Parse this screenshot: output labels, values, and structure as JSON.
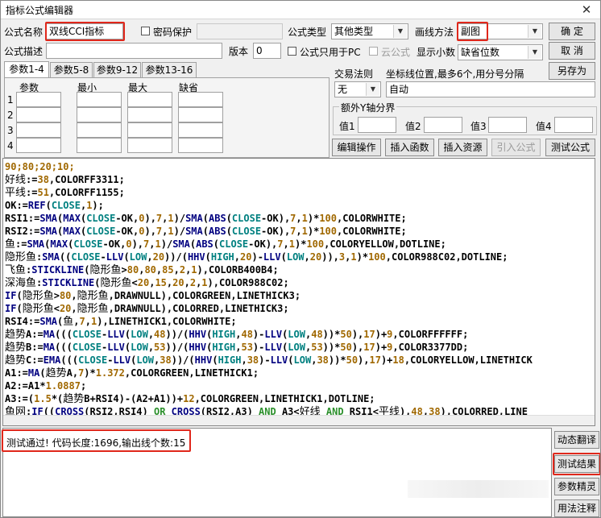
{
  "window": {
    "title": "指标公式编辑器",
    "close_glyph": "✕"
  },
  "form": {
    "name_label": "公式名称",
    "name_value": "双线CCI指标",
    "password_label": "密码保护",
    "type_label": "公式类型",
    "type_value": "其他类型",
    "draw_method_label": "画线方法",
    "draw_method_value": "副图",
    "desc_label": "公式描述",
    "version_label": "版本",
    "version_value": "0",
    "pc_only_label": "公式只用于PC",
    "cloud_label": "云公式",
    "decimals_label": "显示小数",
    "decimals_value": "缺省位数"
  },
  "buttons": {
    "ok": "确  定",
    "cancel": "取  消",
    "save_as": "另存为",
    "edit_ops": "编辑操作",
    "insert_func": "插入函数",
    "insert_res": "插入资源",
    "import_formula": "引入公式",
    "test_formula": "测试公式",
    "dynamic_translate": "动态翻译",
    "test_result": "测试结果",
    "param_wizard": "参数精灵",
    "usage_notes": "用法注释"
  },
  "tabs": [
    "参数1-4",
    "参数5-8",
    "参数9-12",
    "参数13-16"
  ],
  "params": {
    "headers": [
      "参数",
      "最小",
      "最大",
      "缺省"
    ],
    "rows": [
      "1",
      "2",
      "3",
      "4"
    ]
  },
  "trade": {
    "rule_label": "交易法则",
    "rule_value": "无",
    "axis_label": "坐标线位置,最多6个,用分号分隔",
    "axis_value": "自动",
    "extra_axis_label": "额外Y轴分界",
    "value_labels": [
      "值1",
      "值2",
      "值3",
      "值4"
    ]
  },
  "code_lines": [
    [
      [
        "90;80;20;10;",
        "y"
      ]
    ],
    [
      [
        "好线",
        "s"
      ],
      [
        ":=",
        "n"
      ],
      [
        "38",
        "y"
      ],
      [
        ",COLORFF3311;",
        "n"
      ]
    ],
    [
      [
        "平线",
        "s"
      ],
      [
        ":=",
        "n"
      ],
      [
        "51",
        "y"
      ],
      [
        ",COLORFF1155;",
        "n"
      ]
    ],
    [
      [
        "OK:=",
        "n"
      ],
      [
        "REF",
        "f"
      ],
      [
        "(",
        "n"
      ],
      [
        "CLOSE",
        "c"
      ],
      [
        ",",
        "n"
      ],
      [
        "1",
        "y"
      ],
      [
        ");",
        "n"
      ]
    ],
    [
      [
        "RSI1:=",
        "n"
      ],
      [
        "SMA",
        "f"
      ],
      [
        "(",
        "n"
      ],
      [
        "MAX",
        "f"
      ],
      [
        "(",
        "n"
      ],
      [
        "CLOSE",
        "c"
      ],
      [
        "-OK,",
        "n"
      ],
      [
        "0",
        "y"
      ],
      [
        "),",
        "n"
      ],
      [
        "7",
        "y"
      ],
      [
        ",",
        "n"
      ],
      [
        "1",
        "y"
      ],
      [
        ")/",
        "n"
      ],
      [
        "SMA",
        "f"
      ],
      [
        "(",
        "n"
      ],
      [
        "ABS",
        "f"
      ],
      [
        "(",
        "n"
      ],
      [
        "CLOSE",
        "c"
      ],
      [
        "-OK),",
        "n"
      ],
      [
        "7",
        "y"
      ],
      [
        ",",
        "n"
      ],
      [
        "1",
        "y"
      ],
      [
        ")*",
        "n"
      ],
      [
        "100",
        "y"
      ],
      [
        ",COLORWHITE;",
        "n"
      ]
    ],
    [
      [
        "RSI2:=",
        "n"
      ],
      [
        "SMA",
        "f"
      ],
      [
        "(",
        "n"
      ],
      [
        "MAX",
        "f"
      ],
      [
        "(",
        "n"
      ],
      [
        "CLOSE",
        "c"
      ],
      [
        "-OK,",
        "n"
      ],
      [
        "0",
        "y"
      ],
      [
        "),",
        "n"
      ],
      [
        "7",
        "y"
      ],
      [
        ",",
        "n"
      ],
      [
        "1",
        "y"
      ],
      [
        ")/",
        "n"
      ],
      [
        "SMA",
        "f"
      ],
      [
        "(",
        "n"
      ],
      [
        "ABS",
        "f"
      ],
      [
        "(",
        "n"
      ],
      [
        "CLOSE",
        "c"
      ],
      [
        "-OK),",
        "n"
      ],
      [
        "7",
        "y"
      ],
      [
        ",",
        "n"
      ],
      [
        "1",
        "y"
      ],
      [
        ")*",
        "n"
      ],
      [
        "100",
        "y"
      ],
      [
        ",COLORWHITE;",
        "n"
      ]
    ],
    [
      [
        "鱼",
        "s"
      ],
      [
        ":=",
        "n"
      ],
      [
        "SMA",
        "f"
      ],
      [
        "(",
        "n"
      ],
      [
        "MAX",
        "f"
      ],
      [
        "(",
        "n"
      ],
      [
        "CLOSE",
        "c"
      ],
      [
        "-OK,",
        "n"
      ],
      [
        "0",
        "y"
      ],
      [
        "),",
        "n"
      ],
      [
        "7",
        "y"
      ],
      [
        ",",
        "n"
      ],
      [
        "1",
        "y"
      ],
      [
        ")/",
        "n"
      ],
      [
        "SMA",
        "f"
      ],
      [
        "(",
        "n"
      ],
      [
        "ABS",
        "f"
      ],
      [
        "(",
        "n"
      ],
      [
        "CLOSE",
        "c"
      ],
      [
        "-OK),",
        "n"
      ],
      [
        "7",
        "y"
      ],
      [
        ",",
        "n"
      ],
      [
        "1",
        "y"
      ],
      [
        ")*",
        "n"
      ],
      [
        "100",
        "y"
      ],
      [
        ",COLORYELLOW,DOTLINE;",
        "n"
      ]
    ],
    [
      [
        "隐形鱼",
        "s"
      ],
      [
        ":",
        "n"
      ],
      [
        "SMA",
        "f"
      ],
      [
        "((",
        "n"
      ],
      [
        "CLOSE",
        "c"
      ],
      [
        "-",
        "n"
      ],
      [
        "LLV",
        "f"
      ],
      [
        "(",
        "n"
      ],
      [
        "LOW",
        "c"
      ],
      [
        ",",
        "n"
      ],
      [
        "20",
        "y"
      ],
      [
        "))/(",
        "n"
      ],
      [
        "HHV",
        "f"
      ],
      [
        "(",
        "n"
      ],
      [
        "HIGH",
        "c"
      ],
      [
        ",",
        "n"
      ],
      [
        "20",
        "y"
      ],
      [
        ")-",
        "n"
      ],
      [
        "LLV",
        "f"
      ],
      [
        "(",
        "n"
      ],
      [
        "LOW",
        "c"
      ],
      [
        ",",
        "n"
      ],
      [
        "20",
        "y"
      ],
      [
        ")),",
        "n"
      ],
      [
        "3",
        "y"
      ],
      [
        ",",
        "n"
      ],
      [
        "1",
        "y"
      ],
      [
        ")*",
        "n"
      ],
      [
        "100",
        "y"
      ],
      [
        ",COLOR988C02,DOTLINE;",
        "n"
      ]
    ],
    [
      [
        "飞鱼",
        "s"
      ],
      [
        ":",
        "n"
      ],
      [
        "STICKLINE",
        "f"
      ],
      [
        "(",
        "n"
      ],
      [
        "隐形鱼",
        "s"
      ],
      [
        ">",
        "n"
      ],
      [
        "80",
        "y"
      ],
      [
        ",",
        "n"
      ],
      [
        "80",
        "y"
      ],
      [
        ",",
        "n"
      ],
      [
        "85",
        "y"
      ],
      [
        ",",
        "n"
      ],
      [
        "2",
        "y"
      ],
      [
        ",",
        "n"
      ],
      [
        "1",
        "y"
      ],
      [
        "),COLORB400B4;",
        "n"
      ]
    ],
    [
      [
        "深海鱼",
        "s"
      ],
      [
        ":",
        "n"
      ],
      [
        "STICKLINE",
        "f"
      ],
      [
        "(",
        "n"
      ],
      [
        "隐形鱼",
        "s"
      ],
      [
        "<",
        "n"
      ],
      [
        "20",
        "y"
      ],
      [
        ",",
        "n"
      ],
      [
        "15",
        "y"
      ],
      [
        ",",
        "n"
      ],
      [
        "20",
        "y"
      ],
      [
        ",",
        "n"
      ],
      [
        "2",
        "y"
      ],
      [
        ",",
        "n"
      ],
      [
        "1",
        "y"
      ],
      [
        "),COLOR988C02;",
        "n"
      ]
    ],
    [
      [
        "IF",
        "f"
      ],
      [
        "(",
        "n"
      ],
      [
        "隐形鱼",
        "s"
      ],
      [
        ">",
        "n"
      ],
      [
        "80",
        "y"
      ],
      [
        ",",
        "n"
      ],
      [
        "隐形鱼",
        "s"
      ],
      [
        ",DRAWNULL),COLORGREEN,LINETHICK3;",
        "n"
      ]
    ],
    [
      [
        "IF",
        "f"
      ],
      [
        "(",
        "n"
      ],
      [
        "隐形鱼",
        "s"
      ],
      [
        "<",
        "n"
      ],
      [
        "20",
        "y"
      ],
      [
        ",",
        "n"
      ],
      [
        "隐形鱼",
        "s"
      ],
      [
        ",DRAWNULL),COLORRED,LINETHICK3;",
        "n"
      ]
    ],
    [
      [
        "RSI4:=",
        "n"
      ],
      [
        "SMA",
        "f"
      ],
      [
        "(",
        "n"
      ],
      [
        "鱼",
        "s"
      ],
      [
        ",",
        "n"
      ],
      [
        "7",
        "y"
      ],
      [
        ",",
        "n"
      ],
      [
        "1",
        "y"
      ],
      [
        "),LINETHICK1,COLORWHITE;",
        "n"
      ]
    ],
    [
      [
        "趋势",
        "s"
      ],
      [
        "A:=",
        "n"
      ],
      [
        "MA",
        "f"
      ],
      [
        "(((",
        "n"
      ],
      [
        "CLOSE",
        "c"
      ],
      [
        "-",
        "n"
      ],
      [
        "LLV",
        "f"
      ],
      [
        "(",
        "n"
      ],
      [
        "LOW",
        "c"
      ],
      [
        ",",
        "n"
      ],
      [
        "48",
        "y"
      ],
      [
        "))/(",
        "n"
      ],
      [
        "HHV",
        "f"
      ],
      [
        "(",
        "n"
      ],
      [
        "HIGH",
        "c"
      ],
      [
        ",",
        "n"
      ],
      [
        "48",
        "y"
      ],
      [
        ")-",
        "n"
      ],
      [
        "LLV",
        "f"
      ],
      [
        "(",
        "n"
      ],
      [
        "LOW",
        "c"
      ],
      [
        ",",
        "n"
      ],
      [
        "48",
        "y"
      ],
      [
        "))*",
        "n"
      ],
      [
        "50",
        "y"
      ],
      [
        "),",
        "n"
      ],
      [
        "17",
        "y"
      ],
      [
        ")+",
        "n"
      ],
      [
        "9",
        "y"
      ],
      [
        ",COLORFFFFFF;",
        "n"
      ]
    ],
    [
      [
        "趋势",
        "s"
      ],
      [
        "B:=",
        "n"
      ],
      [
        "MA",
        "f"
      ],
      [
        "(((",
        "n"
      ],
      [
        "CLOSE",
        "c"
      ],
      [
        "-",
        "n"
      ],
      [
        "LLV",
        "f"
      ],
      [
        "(",
        "n"
      ],
      [
        "LOW",
        "c"
      ],
      [
        ",",
        "n"
      ],
      [
        "53",
        "y"
      ],
      [
        "))/(",
        "n"
      ],
      [
        "HHV",
        "f"
      ],
      [
        "(",
        "n"
      ],
      [
        "HIGH",
        "c"
      ],
      [
        ",",
        "n"
      ],
      [
        "53",
        "y"
      ],
      [
        ")-",
        "n"
      ],
      [
        "LLV",
        "f"
      ],
      [
        "(",
        "n"
      ],
      [
        "LOW",
        "c"
      ],
      [
        ",",
        "n"
      ],
      [
        "53",
        "y"
      ],
      [
        "))*",
        "n"
      ],
      [
        "50",
        "y"
      ],
      [
        "),",
        "n"
      ],
      [
        "17",
        "y"
      ],
      [
        ")+",
        "n"
      ],
      [
        "9",
        "y"
      ],
      [
        ",COLOR3377DD;",
        "n"
      ]
    ],
    [
      [
        "趋势",
        "s"
      ],
      [
        "C:=",
        "n"
      ],
      [
        "EMA",
        "f"
      ],
      [
        "(((",
        "n"
      ],
      [
        "CLOSE",
        "c"
      ],
      [
        "-",
        "n"
      ],
      [
        "LLV",
        "f"
      ],
      [
        "(",
        "n"
      ],
      [
        "LOW",
        "c"
      ],
      [
        ",",
        "n"
      ],
      [
        "38",
        "y"
      ],
      [
        "))/(",
        "n"
      ],
      [
        "HHV",
        "f"
      ],
      [
        "(",
        "n"
      ],
      [
        "HIGH",
        "c"
      ],
      [
        ",",
        "n"
      ],
      [
        "38",
        "y"
      ],
      [
        ")-",
        "n"
      ],
      [
        "LLV",
        "f"
      ],
      [
        "(",
        "n"
      ],
      [
        "LOW",
        "c"
      ],
      [
        ",",
        "n"
      ],
      [
        "38",
        "y"
      ],
      [
        "))*",
        "n"
      ],
      [
        "50",
        "y"
      ],
      [
        "),",
        "n"
      ],
      [
        "17",
        "y"
      ],
      [
        ")+",
        "n"
      ],
      [
        "18",
        "y"
      ],
      [
        ",COLORYELLOW,LINETHICK",
        "n"
      ]
    ],
    [
      [
        "A1:=",
        "n"
      ],
      [
        "MA",
        "f"
      ],
      [
        "(",
        "n"
      ],
      [
        "趋势",
        "s"
      ],
      [
        "A,",
        "n"
      ],
      [
        "7",
        "y"
      ],
      [
        ")*",
        "n"
      ],
      [
        "1.372",
        "y"
      ],
      [
        ",COLORGREEN,LINETHICK1;",
        "n"
      ]
    ],
    [
      [
        "A2:=",
        "n"
      ],
      [
        "A1*",
        "n"
      ],
      [
        "1.0887",
        "y"
      ],
      [
        ";",
        "n"
      ]
    ],
    [
      [
        "A3:=(",
        "n"
      ],
      [
        "1.5",
        "y"
      ],
      [
        "*(",
        "n"
      ],
      [
        "趋势",
        "s"
      ],
      [
        "B+RSI4)-(A2+A1))+",
        "n"
      ],
      [
        "12",
        "y"
      ],
      [
        ",COLORGREEN,LINETHICK1,DOTLINE;",
        "n"
      ]
    ],
    [
      [
        "鱼网",
        "s"
      ],
      [
        ":",
        "n"
      ],
      [
        "IF",
        "f"
      ],
      [
        "((",
        "n"
      ],
      [
        "CROSS",
        "f"
      ],
      [
        "(RSI2,RSI4) ",
        "n"
      ],
      [
        "OR",
        "t"
      ],
      [
        " ",
        "n"
      ],
      [
        "CROSS",
        "f"
      ],
      [
        "(RSI2,A3) ",
        "n"
      ],
      [
        "AND",
        "t"
      ],
      [
        " A3<",
        "n"
      ],
      [
        "好线",
        "s"
      ],
      [
        " ",
        "n"
      ],
      [
        "AND",
        "t"
      ],
      [
        " RSI1<",
        "n"
      ],
      [
        "平线",
        "s"
      ],
      [
        "),",
        "n"
      ],
      [
        "48",
        "y"
      ],
      [
        ",",
        "n"
      ],
      [
        "38",
        "y"
      ],
      [
        "),COLORRED,LINE",
        "n"
      ]
    ]
  ],
  "status": {
    "text": "测试通过! 代码长度:1696,输出线个数:15"
  }
}
